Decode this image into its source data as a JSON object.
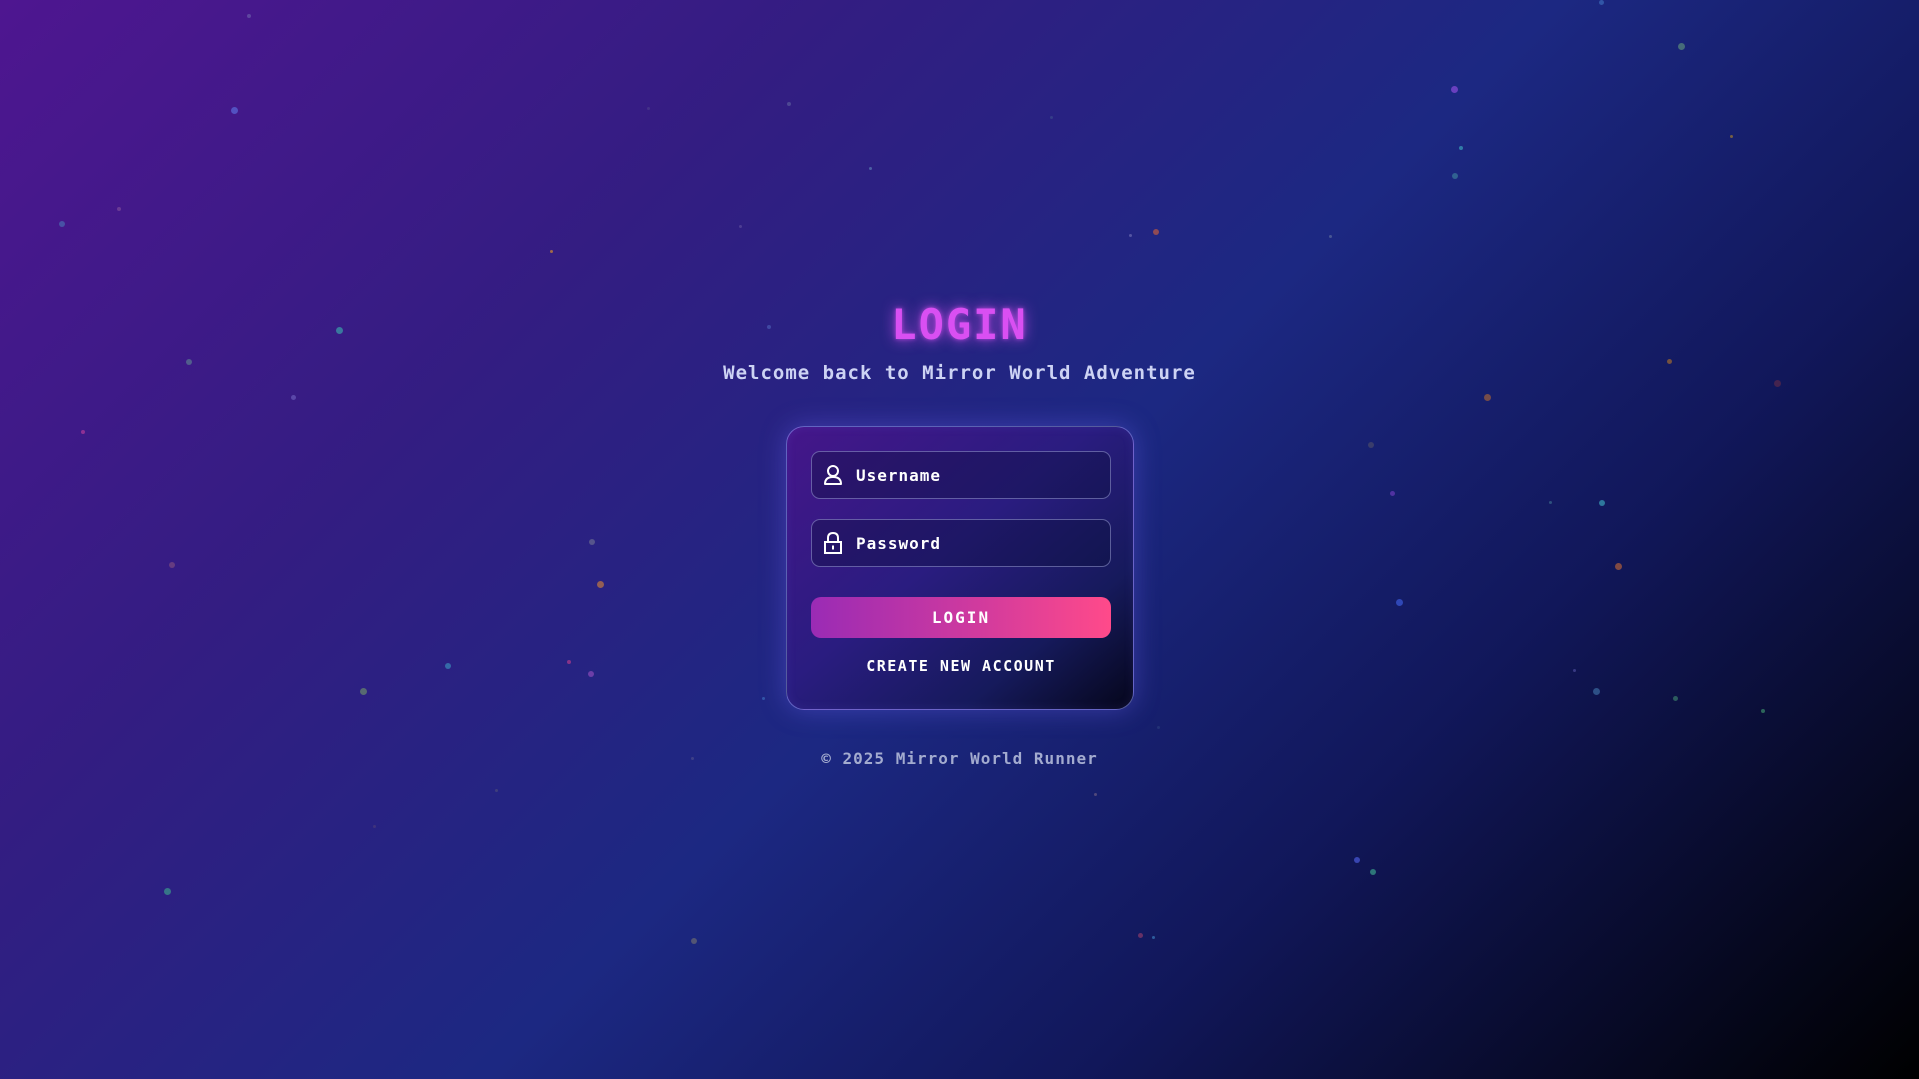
{
  "header": {
    "title": "LOGIN",
    "subtitle": "Welcome back to Mirror World Adventure"
  },
  "form": {
    "username_placeholder": "Username",
    "username_value": "",
    "username_icon": "user-icon",
    "password_placeholder": "Password",
    "password_value": "",
    "password_icon": "lock-icon",
    "login_label": "LOGIN",
    "create_account_label": "CREATE NEW ACCOUNT"
  },
  "footer": {
    "copyright": "© 2025 Mirror World Runner"
  },
  "colors": {
    "title_accent": "#d94ff2",
    "button_start": "#9a2bb5",
    "button_end": "#ff4a8a",
    "background_start": "#4e1690",
    "background_end": "#000000"
  }
}
